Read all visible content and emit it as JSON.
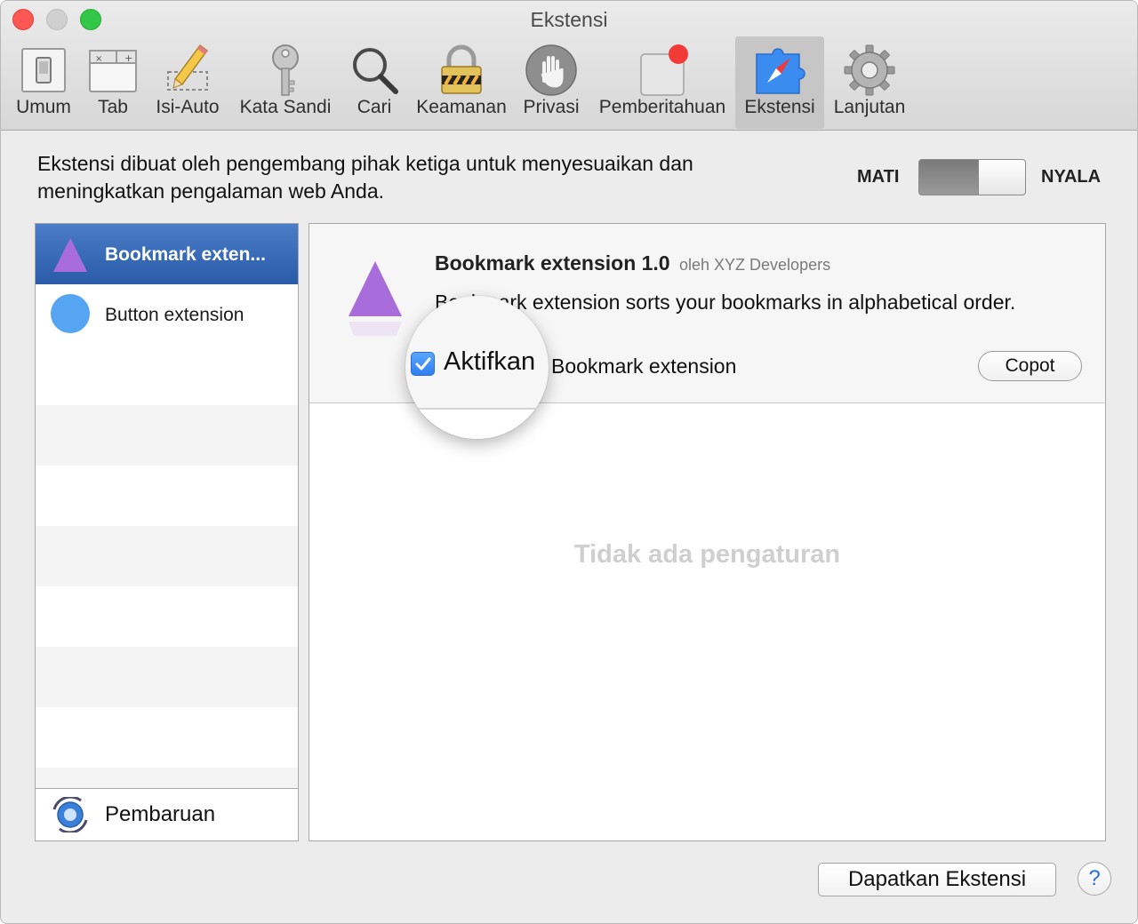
{
  "window": {
    "title": "Ekstensi"
  },
  "toolbar": {
    "items": [
      {
        "label": "Umum",
        "icon": "general-switch-icon"
      },
      {
        "label": "Tab",
        "icon": "tabs-icon"
      },
      {
        "label": "Isi-Auto",
        "icon": "pencil-icon"
      },
      {
        "label": "Kata Sandi",
        "icon": "key-icon"
      },
      {
        "label": "Cari",
        "icon": "search-icon"
      },
      {
        "label": "Keamanan",
        "icon": "lock-icon"
      },
      {
        "label": "Privasi",
        "icon": "hand-icon"
      },
      {
        "label": "Pemberitahuan",
        "icon": "notification-icon"
      },
      {
        "label": "Ekstensi",
        "icon": "puzzle-compass-icon"
      },
      {
        "label": "Lanjutan",
        "icon": "gear-icon"
      }
    ],
    "selected": "Ekstensi"
  },
  "description": "Ekstensi dibuat oleh pengembang pihak ketiga untuk menyesuaikan dan meningkatkan pengalaman web Anda.",
  "master_switch": {
    "off_label": "MATI",
    "on_label": "NYALA",
    "state": "on"
  },
  "extensions": [
    {
      "name": "Bookmark exten...",
      "icon": "purple-triangle-icon",
      "selected": true
    },
    {
      "name": "Button extension",
      "icon": "blue-circle-icon",
      "selected": false
    }
  ],
  "updates": {
    "label": "Pembaruan",
    "icon": "software-update-icon"
  },
  "detail": {
    "title": "Bookmark extension 1.0",
    "by": "oleh XYZ Developers",
    "desc": "Bookmark extension sorts your bookmarks in alphabetical order.",
    "enable_label": "Aktifkan",
    "enable_target": "Bookmark extension",
    "enabled": true,
    "uninstall_label": "Copot",
    "no_settings": "Tidak ada pengaturan"
  },
  "footer": {
    "get_extensions_label": "Dapatkan Ekstensi",
    "help_label": "?"
  },
  "colors": {
    "accent": "#2f7ff0",
    "selection": "#2a5ba8",
    "triangle": "#a86cdb",
    "circle": "#56a5f2"
  }
}
